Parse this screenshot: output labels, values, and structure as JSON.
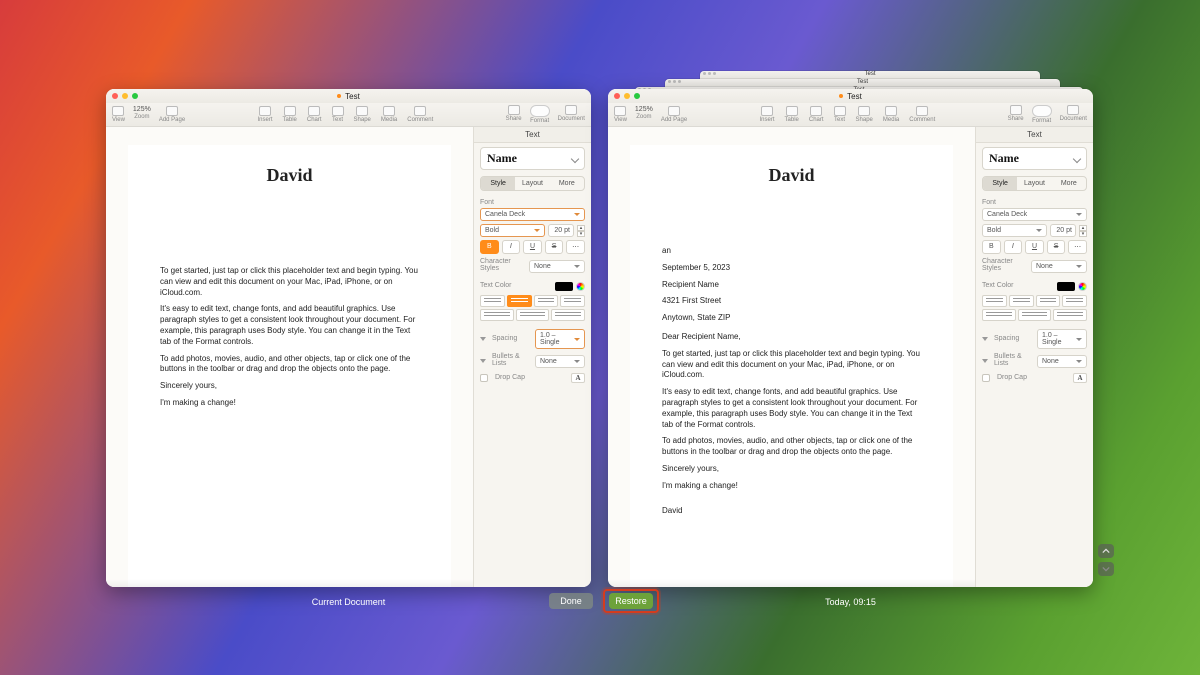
{
  "window_title": "Test",
  "toolbar": {
    "view": "View",
    "zoom": "Zoom",
    "zoom_val": "125% ",
    "add_page": "Add Page",
    "insert": "Insert",
    "table": "Table",
    "chart": "Chart",
    "text": "Text",
    "shape": "Shape",
    "media": "Media",
    "comment": "Comment",
    "share": "Share",
    "format": "Format",
    "document": "Document"
  },
  "panel": {
    "header": "Text",
    "style_name": "Name",
    "tabs": {
      "style": "Style",
      "layout": "Layout",
      "more": "More"
    },
    "font_label": "Font",
    "font_family": "Canela Deck",
    "font_weight": "Bold",
    "font_size": "20",
    "font_unit": "pt",
    "char_styles_label": "Character Styles",
    "char_styles_value": "None",
    "text_color_label": "Text Color",
    "spacing_label": "Spacing",
    "spacing_value": "1.0 – Single",
    "bullets_label": "Bullets & Lists",
    "bullets_value": "None",
    "dropcap_label": "Drop Cap",
    "dropcap_letter": "A"
  },
  "left_doc": {
    "heading": "David",
    "paragraphs": [
      "To get started, just tap or click this placeholder text and begin typing. You can view and edit this document on your Mac, iPad, iPhone, or on iCloud.com.",
      "It's easy to edit text, change fonts, and add beautiful graphics. Use paragraph styles to get a consistent look throughout your document. For example, this paragraph uses Body style. You can change it in the Text tab of the Format controls.",
      "To add photos, movies, audio, and other objects, tap or click one of the buttons in the toolbar or drag and drop the objects onto the page.",
      "Sincerely yours,",
      "I'm making a change!"
    ]
  },
  "right_doc": {
    "heading": "David",
    "sender_short": "an",
    "date": "September 5, 2023",
    "recipient_name": "Recipient Name",
    "recipient_street": "4321 First Street",
    "recipient_city": "Anytown, State ZIP",
    "salutation": "Dear Recipient Name,",
    "paragraphs": [
      "To get started, just tap or click this placeholder text and begin typing. You can view and edit this document on your Mac, iPad, iPhone, or on iCloud.com.",
      "It's easy to edit text, change fonts, and add beautiful graphics. Use paragraph styles to get a consistent look throughout your document. For example, this paragraph uses Body style. You can change it in the Text tab of the Format controls.",
      "To add photos, movies, audio, and other objects, tap or click one of the buttons in the toolbar or drag and drop the objects onto the page.",
      "Sincerely yours,",
      "I'm making a change!"
    ],
    "signature": "David"
  },
  "versions_ui": {
    "current_label": "Current Document",
    "history_label": "Today, 09:15",
    "done": "Done",
    "restore": "Restore"
  },
  "ghost_titles": [
    "Test",
    "Test",
    "Test"
  ]
}
